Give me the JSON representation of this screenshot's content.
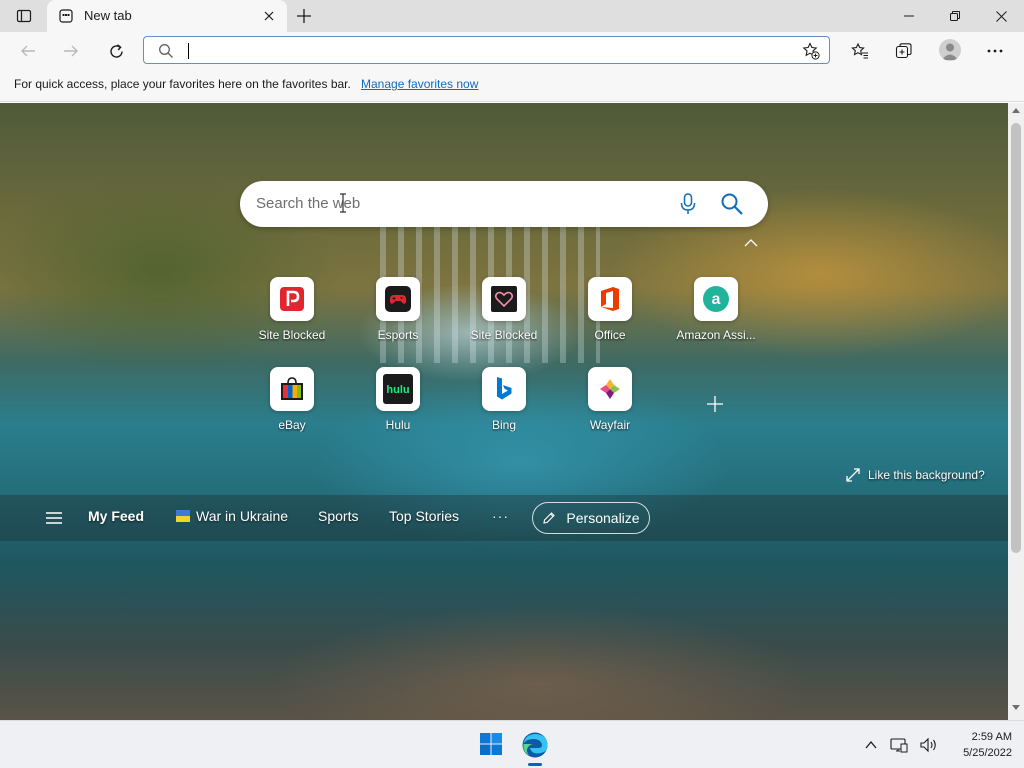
{
  "tab": {
    "title": "New tab"
  },
  "toolbar": {
    "address_value": ""
  },
  "favorites_bar": {
    "message": "For quick access, place your favorites here on the favorites bar.",
    "link": "Manage favorites now"
  },
  "search": {
    "placeholder": "Search the web"
  },
  "tiles": [
    {
      "label": "Site Blocked",
      "icon": "site-blocked-p-icon",
      "color": "#e0262f"
    },
    {
      "label": "Esports",
      "icon": "gamepad-icon",
      "color": "#e0262f"
    },
    {
      "label": "Site Blocked",
      "icon": "heart-icon",
      "color": "#1b1b1b"
    },
    {
      "label": "Office",
      "icon": "office-icon",
      "color": "#eb3c00"
    },
    {
      "label": "Amazon Assi...",
      "icon": "amazon-assistant-icon",
      "color": "#21b39c"
    },
    {
      "label": "eBay",
      "icon": "shopping-bag-icon",
      "color": "#e53238"
    },
    {
      "label": "Hulu",
      "icon": "hulu-icon",
      "color": "#1ce783"
    },
    {
      "label": "Bing",
      "icon": "bing-icon",
      "color": "#0078d4"
    },
    {
      "label": "Wayfair",
      "icon": "wayfair-icon",
      "color": "#7f187f"
    }
  ],
  "background": {
    "like_text": "Like this background?"
  },
  "feed": {
    "my_feed": "My Feed",
    "war_in_ukraine": "War in Ukraine",
    "sports": "Sports",
    "top_stories": "Top Stories",
    "more": "···",
    "personalize": "Personalize"
  },
  "taskbar": {
    "time": "2:59 AM",
    "date": "5/25/2022"
  }
}
